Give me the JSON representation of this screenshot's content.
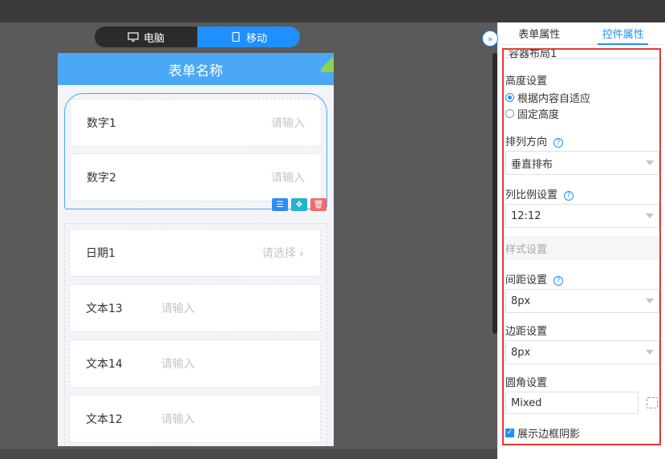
{
  "device_toggle": {
    "desktop_label": "电脑",
    "mobile_label": "移动",
    "active": "mobile"
  },
  "form": {
    "title": "表单名称",
    "fields": [
      {
        "label": "数字1",
        "placeholder": "请输入"
      },
      {
        "label": "数字2",
        "placeholder": "请输入"
      },
      {
        "label": "日期1",
        "placeholder": "请选择"
      },
      {
        "label": "文本13",
        "placeholder": "请输入"
      },
      {
        "label": "文本14",
        "placeholder": "请输入"
      },
      {
        "label": "文本12",
        "placeholder": "请输入"
      }
    ],
    "date_chevron": "›"
  },
  "panel": {
    "tabs": [
      {
        "label": "表单属性",
        "active": false
      },
      {
        "label": "控件属性",
        "active": true
      }
    ],
    "collapse_glyph": "»",
    "clipped_title": "容器布局1",
    "height": {
      "label": "高度设置",
      "options": [
        {
          "label": "根据内容自适应",
          "checked": true
        },
        {
          "label": "固定高度",
          "checked": false
        }
      ]
    },
    "direction": {
      "label": "排列方向",
      "value": "垂直排布"
    },
    "ratio": {
      "label": "列比例设置",
      "value": "12:12"
    },
    "style_section": "样式设置",
    "gap": {
      "label": "间距设置",
      "value": "8px"
    },
    "margin": {
      "label": "边距设置",
      "value": "8px"
    },
    "radius": {
      "label": "圆角设置",
      "value": "Mixed"
    },
    "shadow": {
      "label": "展示边框阴影",
      "checked": true
    },
    "help_glyph": "?"
  },
  "colors": {
    "accent": "#1e90ff",
    "header": "#4aa8f5",
    "highlight_border": "#e53935"
  }
}
